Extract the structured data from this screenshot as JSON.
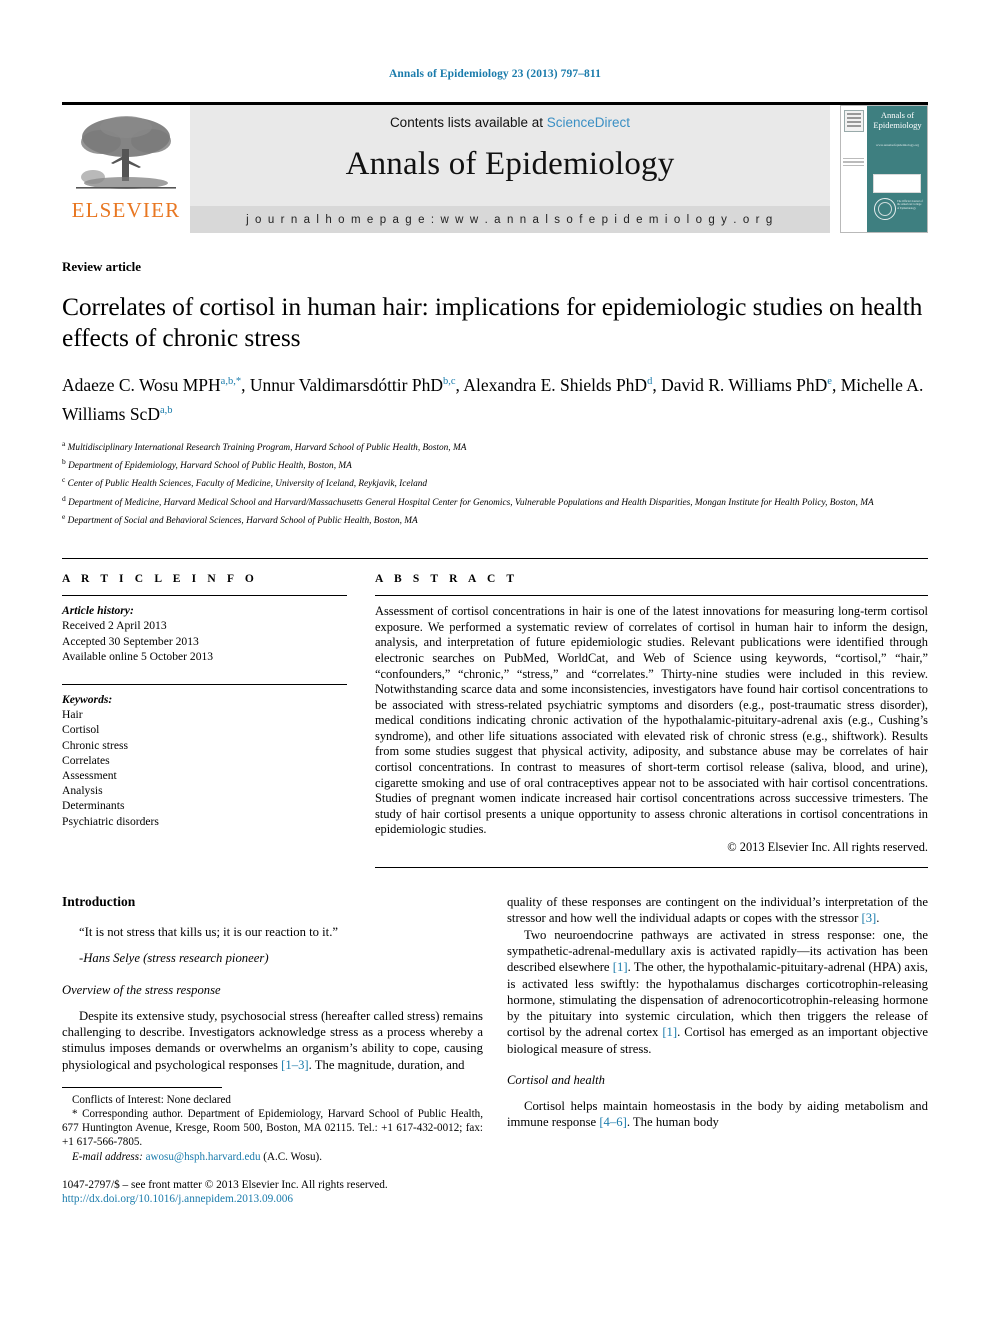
{
  "running_head": "Annals of Epidemiology 23 (2013) 797–811",
  "masthead": {
    "publisher": "ELSEVIER",
    "contents_prefix": "Contents lists available at ",
    "contents_link": "ScienceDirect",
    "journal_title": "Annals of Epidemiology",
    "homepage": "j o u r n a l   h o m e p a g e :   w w w . a n n a l s o f e p i d e m i o l o g y . o r g",
    "cover": {
      "title": "Annals of Epidemiology",
      "url": "www.annalsofepidemiology.org",
      "seal_text": "The Official Journal of the American College of Epidemiology"
    }
  },
  "article": {
    "type": "Review article",
    "title": "Correlates of cortisol in human hair: implications for epidemiologic studies on health effects of chronic stress",
    "authors": [
      {
        "name": "Adaeze C. Wosu MPH",
        "sup": "a,b,*"
      },
      {
        "name": "Unnur Valdimarsdóttir PhD",
        "sup": "b,c"
      },
      {
        "name": "Alexandra E. Shields PhD",
        "sup": "d"
      },
      {
        "name": "David R. Williams PhD",
        "sup": "e"
      },
      {
        "name": "Michelle A. Williams ScD",
        "sup": "a,b"
      }
    ],
    "affiliations": [
      {
        "mark": "a",
        "text": "Multidisciplinary International Research Training Program, Harvard School of Public Health, Boston, MA"
      },
      {
        "mark": "b",
        "text": "Department of Epidemiology, Harvard School of Public Health, Boston, MA"
      },
      {
        "mark": "c",
        "text": "Center of Public Health Sciences, Faculty of Medicine, University of Iceland, Reykjavik, Iceland"
      },
      {
        "mark": "d",
        "text": "Department of Medicine, Harvard Medical School and Harvard/Massachusetts General Hospital Center for Genomics, Vulnerable Populations and Health Disparities, Mongan Institute for Health Policy, Boston, MA"
      },
      {
        "mark": "e",
        "text": "Department of Social and Behavioral Sciences, Harvard School of Public Health, Boston, MA"
      }
    ]
  },
  "article_info": {
    "heading": "A R T I C L E  I N F O",
    "history_label": "Article history:",
    "history": [
      "Received 2 April 2013",
      "Accepted 30 September 2013",
      "Available online 5 October 2013"
    ],
    "keywords_label": "Keywords:",
    "keywords": [
      "Hair",
      "Cortisol",
      "Chronic stress",
      "Correlates",
      "Assessment",
      "Analysis",
      "Determinants",
      "Psychiatric disorders"
    ]
  },
  "abstract": {
    "heading": "A B S T R A C T",
    "text": "Assessment of cortisol concentrations in hair is one of the latest innovations for measuring long-term cortisol exposure. We performed a systematic review of correlates of cortisol in human hair to inform the design, analysis, and interpretation of future epidemiologic studies. Relevant publications were identified through electronic searches on PubMed, WorldCat, and Web of Science using keywords, “cortisol,” “hair,” “confounders,” “chronic,” “stress,” and “correlates.” Thirty-nine studies were included in this review. Notwithstanding scarce data and some inconsistencies, investigators have found hair cortisol concentrations to be associated with stress-related psychiatric symptoms and disorders (e.g., post-traumatic stress disorder), medical conditions indicating chronic activation of the hypothalamic-pituitary-adrenal axis (e.g., Cushing’s syndrome), and other life situations associated with elevated risk of chronic stress (e.g., shiftwork). Results from some studies suggest that physical activity, adiposity, and substance abuse may be correlates of hair cortisol concentrations. In contrast to measures of short-term cortisol release (saliva, blood, and urine), cigarette smoking and use of oral contraceptives appear not to be associated with hair cortisol concentrations. Studies of pregnant women indicate increased hair cortisol concentrations across successive trimesters. The study of hair cortisol presents a unique opportunity to assess chronic alterations in cortisol concentrations in epidemiologic studies.",
    "copyright": "© 2013 Elsevier Inc. All rights reserved."
  },
  "body": {
    "left": {
      "intro_heading": "Introduction",
      "quote": "“It is not stress that kills us; it is our reaction to it.”",
      "quote_attrib": "-Hans Selye (stress research pioneer)",
      "subheading": "Overview of the stress response",
      "paragraph_1a": "Despite its extensive study, psychosocial stress (hereafter called stress) remains challenging to describe. Investigators acknowledge stress as a process whereby a stimulus imposes demands or overwhelms an organism’s ability to cope, causing physiological and psychological responses ",
      "paragraph_1_ref": "[1–3]",
      "paragraph_1b": ". The magnitude, duration, and"
    },
    "right": {
      "paragraph_1a": "quality of these responses are contingent on the individual’s interpretation of the stressor and how well the individual adapts or copes with the stressor ",
      "paragraph_1_ref": "[3]",
      "paragraph_1b": ".",
      "paragraph_2a": "Two neuroendocrine pathways are activated in stress response: one, the sympathetic-adrenal-medullary axis is activated rapidly—its activation has been described elsewhere ",
      "paragraph_2_ref1": "[1]",
      "paragraph_2b": ". The other, the hypothalamic-pituitary-adrenal (HPA) axis, is activated less swiftly: the hypothalamus discharges corticotrophin-releasing hormone, stimulating the dispensation of adrenocorticotrophin-releasing hormone by the pituitary into systemic circulation, which then triggers the release of cortisol by the adrenal cortex ",
      "paragraph_2_ref2": "[1]",
      "paragraph_2c": ". Cortisol has emerged as an important objective biological measure of stress.",
      "subheading": "Cortisol and health",
      "paragraph_3a": "Cortisol helps maintain homeostasis in the body by aiding metabolism and immune response ",
      "paragraph_3_ref": "[4–6]",
      "paragraph_3b": ". The human body"
    }
  },
  "footnotes": {
    "conflicts": "Conflicts of Interest: None declared",
    "corresponding": "* Corresponding author. Department of Epidemiology, Harvard School of Public Health, 677 Huntington Avenue, Kresge, Room 500, Boston, MA 02115. Tel.: +1 617-432-0012; fax: +1 617-566-7805.",
    "email_label": "E-mail address:",
    "email": "awosu@hsph.harvard.edu",
    "email_suffix": " (A.C. Wosu).",
    "front_matter": "1047-2797/$ – see front matter © 2013 Elsevier Inc. All rights reserved.",
    "doi": "http://dx.doi.org/10.1016/j.annepidem.2013.09.006"
  }
}
